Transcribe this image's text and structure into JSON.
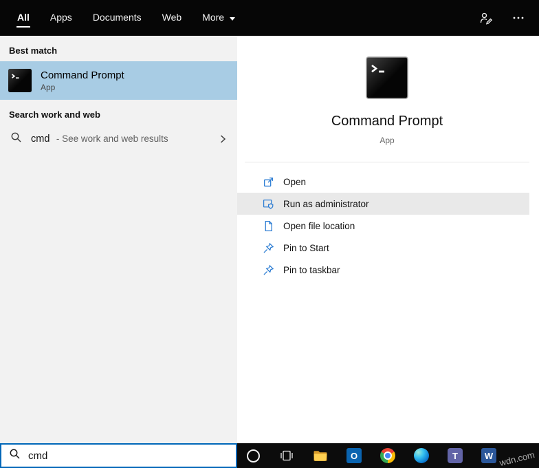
{
  "topbar": {
    "tabs": [
      {
        "label": "All",
        "selected": true
      },
      {
        "label": "Apps",
        "selected": false
      },
      {
        "label": "Documents",
        "selected": false
      },
      {
        "label": "Web",
        "selected": false
      },
      {
        "label": "More",
        "selected": false,
        "has_dropdown": true
      }
    ],
    "icons": [
      "feedback-icon",
      "ellipsis-icon"
    ]
  },
  "left_panel": {
    "best_match_header": "Best match",
    "best_match": {
      "title": "Command Prompt",
      "subtitle": "App",
      "icon": "command-prompt-icon"
    },
    "search_web_header": "Search work and web",
    "suggestion": {
      "query": "cmd",
      "description": "- See work and web results",
      "icon": "search-icon"
    },
    "search_box": {
      "value": "cmd",
      "icon": "search-icon"
    }
  },
  "right_panel": {
    "preview": {
      "title": "Command Prompt",
      "subtitle": "App",
      "icon": "command-prompt-icon"
    },
    "actions": [
      {
        "label": "Open",
        "icon": "open-icon",
        "highlighted": false
      },
      {
        "label": "Run as administrator",
        "icon": "run-as-admin-icon",
        "highlighted": true
      },
      {
        "label": "Open file location",
        "icon": "file-location-icon",
        "highlighted": false
      },
      {
        "label": "Pin to Start",
        "icon": "pin-icon",
        "highlighted": false
      },
      {
        "label": "Pin to taskbar",
        "icon": "pin-icon",
        "highlighted": false
      }
    ]
  },
  "taskbar": {
    "icons": [
      {
        "name": "cortana-icon"
      },
      {
        "name": "task-view-icon"
      },
      {
        "name": "file-explorer-icon"
      },
      {
        "name": "outlook-icon",
        "glyph": "O"
      },
      {
        "name": "chrome-icon"
      },
      {
        "name": "edge-icon"
      },
      {
        "name": "teams-icon",
        "glyph": "T"
      },
      {
        "name": "word-icon",
        "glyph": "W"
      }
    ]
  },
  "watermark": "wdn.com",
  "colors": {
    "accent_blue": "#0067b8",
    "selection_blue": "#a8cce4",
    "row_highlight": "#e9e9e9",
    "action_icon_blue": "#2b7cd3",
    "topbar_black": "#060606"
  }
}
